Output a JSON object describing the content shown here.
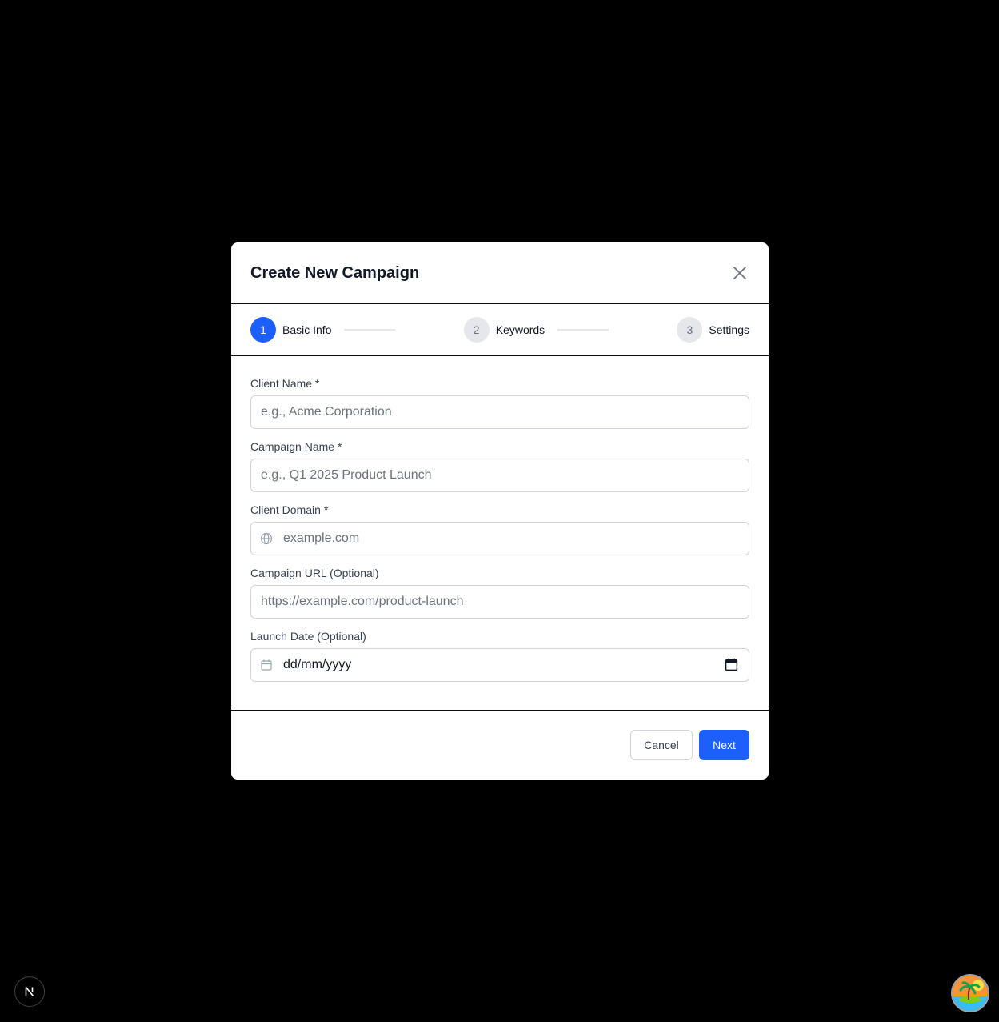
{
  "modal": {
    "title": "Create New Campaign"
  },
  "stepper": {
    "steps": [
      {
        "number": "1",
        "label": "Basic Info",
        "active": true
      },
      {
        "number": "2",
        "label": "Keywords",
        "active": false
      },
      {
        "number": "3",
        "label": "Settings",
        "active": false
      }
    ]
  },
  "form": {
    "client_name": {
      "label": "Client Name *",
      "placeholder": "e.g., Acme Corporation",
      "value": ""
    },
    "campaign_name": {
      "label": "Campaign Name *",
      "placeholder": "e.g., Q1 2025 Product Launch",
      "value": ""
    },
    "client_domain": {
      "label": "Client Domain *",
      "placeholder": "example.com",
      "value": "",
      "icon": "globe-icon"
    },
    "campaign_url": {
      "label": "Campaign URL (Optional)",
      "placeholder": "https://example.com/product-launch",
      "value": ""
    },
    "launch_date": {
      "label": "Launch Date (Optional)",
      "display": "dd/mm/yyyy",
      "icon": "calendar-icon"
    }
  },
  "footer": {
    "cancel_label": "Cancel",
    "next_label": "Next"
  },
  "colors": {
    "accent": "#1d5ffb",
    "backdrop": "#000000"
  }
}
